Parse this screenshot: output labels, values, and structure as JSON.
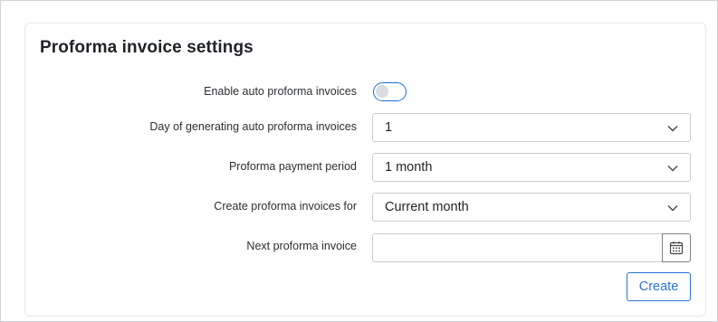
{
  "card": {
    "title": "Proforma invoice settings"
  },
  "fields": {
    "auto_proforma": {
      "label": "Enable auto proforma invoices",
      "enabled": false
    },
    "day_generating": {
      "label": "Day of generating auto proforma invoices",
      "value": "1"
    },
    "payment_period": {
      "label": "Proforma payment period",
      "value": "1 month"
    },
    "create_for": {
      "label": "Create proforma invoices for",
      "value": "Current month"
    },
    "next_invoice": {
      "label": "Next proforma invoice",
      "value": ""
    }
  },
  "actions": {
    "create_label": "Create"
  },
  "icons": {
    "dropdown": "chevron-down-icon",
    "calendar": "calendar-icon"
  },
  "colors": {
    "accent": "#2a73d6"
  }
}
